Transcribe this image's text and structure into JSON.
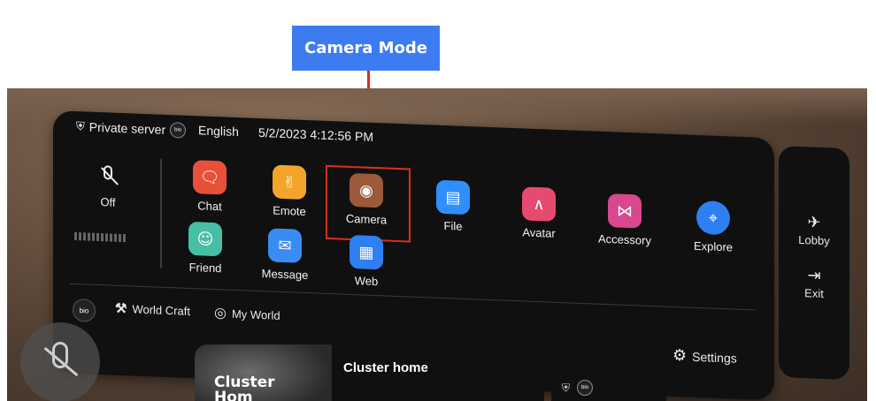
{
  "callout": {
    "label": "Camera Mode"
  },
  "header": {
    "server_icon": "shield-icon",
    "server": "Private server",
    "language_icon": "bio-badge",
    "language": "English",
    "datetime": "5/2/2023 4:12:56 PM"
  },
  "mic": {
    "state": "Off",
    "icon": "mic-off-icon"
  },
  "apps": [
    {
      "label": "Chat",
      "icon": "chat-icon",
      "color": "#e8503a"
    },
    {
      "label": "Emote",
      "icon": "thumbs-up-icon",
      "color": "#f3a52b"
    },
    {
      "label": "Camera",
      "icon": "camera-icon",
      "color": "#9b5a3a"
    },
    {
      "label": "File",
      "icon": "folder-icon",
      "color": "#2f8fff"
    },
    {
      "label": "Avatar",
      "icon": "hanger-icon",
      "color": "#e64a6e"
    },
    {
      "label": "Accessory",
      "icon": "bow-icon",
      "color": "#d9488f"
    },
    {
      "label": "Explore",
      "icon": "compass-icon",
      "color": "#2f7ff0"
    },
    {
      "label": "Friend",
      "icon": "friends-icon",
      "color": "#45bfa6"
    },
    {
      "label": "Message",
      "icon": "mail-icon",
      "color": "#3a8cf5"
    },
    {
      "label": "Web",
      "icon": "web-icon",
      "color": "#2f7ff0"
    }
  ],
  "bottom": {
    "bio": "bio",
    "world_craft": "World Craft",
    "my_world": "My World",
    "settings": "Settings"
  },
  "side": {
    "lobby": "Lobby",
    "exit": "Exit"
  },
  "cards": {
    "home_title": "Cluster home",
    "thumb_text": "Cluster",
    "thumb_sub": "Hom"
  }
}
